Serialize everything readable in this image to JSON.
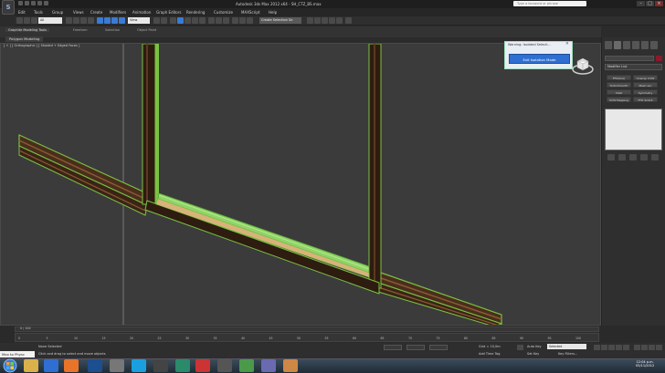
{
  "title_bar": {
    "title": "Autodesk 3ds Max 2012 x64 - SH_CTZ_BS.max",
    "search_placeholder": "Type a keyword or phrase"
  },
  "menu": [
    "Edit",
    "Tools",
    "Group",
    "Views",
    "Create",
    "Modifiers",
    "Animation",
    "Graph Editors",
    "Rendering",
    "Customize",
    "MAXScript",
    "Help"
  ],
  "toolbar": {
    "selection_filter": "All",
    "reference_coord": "View",
    "named_selection": "Create Selection Se"
  },
  "ribbon": {
    "tabs": [
      "Graphite Modeling Tools",
      "Freeform",
      "Selection",
      "Object Paint"
    ],
    "panel_label": "Polygon Modeling"
  },
  "viewport": {
    "label": "[ + ] [ Orthographic ] [ Shaded + Edged Faces ]"
  },
  "isolated_dialog": {
    "title": "Warning: Isolated Selecti...",
    "close": "✕",
    "button_label": "Exit Isolation Mode"
  },
  "command_panel": {
    "modifier_list": "Modifier List",
    "modifier_buttons": [
      "FFD(box)",
      "Unwrap UVW",
      "TurboSmooth",
      "Mesh sel.",
      "Shell",
      "Symmetry",
      "UVW Mapping",
      "FFD 4x4x4"
    ]
  },
  "timeline": {
    "frame_display": "0 / 100",
    "ticks": [
      "0",
      "5",
      "10",
      "15",
      "20",
      "25",
      "30",
      "35",
      "40",
      "45",
      "50",
      "55",
      "60",
      "65",
      "70",
      "75",
      "80",
      "85",
      "90",
      "95",
      "100"
    ]
  },
  "status": {
    "maxscript_value": "Max to Physc",
    "status_line": "None Selected",
    "prompt_line": "Click and drag to select and move objects",
    "grid": "Grid = 10,0m",
    "add_time_tag": "Add Time Tag",
    "auto_key_label": "Auto Key",
    "selected_value": "Selected",
    "set_key_label": "Set Key",
    "key_filters_label": "Key Filters..."
  },
  "taskbar": {
    "time": "12:04 p.m.",
    "date": "05/11/2012"
  },
  "colors": {
    "viewport_bg": "#3b3b3b",
    "selection_green": "#7ac143",
    "wood_dark": "#4a2e1c",
    "dialog_button": "#2f6fd1",
    "accent_red": "#8b1a2e"
  }
}
